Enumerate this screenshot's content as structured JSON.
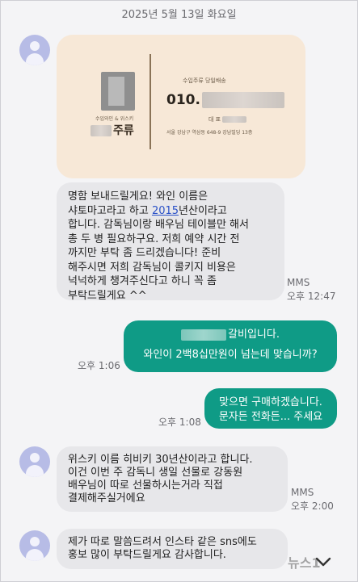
{
  "date_header": "2025년 5월 13일 화요일",
  "card": {
    "company_tag": "수입와인 & 위스키",
    "brand_suffix": "주류",
    "service_label": "수입주류 당일배송",
    "phone_prefix": "010.",
    "rep_label": "대 표",
    "address": "서울 강남구 역삼동 648-9 강남빌딩 13층"
  },
  "messages": [
    {
      "id": "m1",
      "direction": "incoming",
      "lines": [
        "명함 보내드릴게요! 와인 이름은",
        "샤토마고라고 하고 ",
        "합니다. 감독님이랑 배우님 테이블만 해서",
        "총 두 병 필요하구요. 저희 예약 시간 전",
        "까지만 부탁 좀 드리겠습니다! 준비",
        "해주시면 저희 감독님이 콜키지 비용은",
        "넉넉하게 챙겨주신다고 하니 꼭 좀",
        "부탁드릴게요 ^^"
      ],
      "link_text": "2015",
      "link_after": "년산이라고",
      "type": "MMS",
      "time": "오후 12:47"
    },
    {
      "id": "m2",
      "direction": "outgoing",
      "line1_suffix": "갈비입니다.",
      "line2": "와인이 2백8십만원이  넘는데  맞습니까?",
      "time": "오후 1:06"
    },
    {
      "id": "m3",
      "direction": "outgoing",
      "text": "맞으면 구매하겠습니다.\n문자든 전화든... 주세요",
      "time": "오후 1:08"
    },
    {
      "id": "m4",
      "direction": "incoming",
      "text": "위스키 이름 히비키 30년산이라고 합니다.\n이건 이번 주 감독니 생일 선물로 강동원\n배우님이 따로 선물하시는거라 직접\n결제해주실거에요",
      "type": "MMS",
      "time": "오후 2:00"
    },
    {
      "id": "m5",
      "direction": "incoming",
      "text": "제가 따로 말씀드려서 인스타 같은 sns에도\n홍보 많이 부탁드릴게요 감사합니다."
    }
  ],
  "watermark": "뉴스1",
  "icons": {
    "avatar": "person-avatar-icon",
    "scroll": "chevron-down-icon"
  },
  "colors": {
    "incoming_bubble": "#e7e7ea",
    "outgoing_bubble": "#0f9b86",
    "avatar": "#b7bce6",
    "card_bg": "#f7e8d7",
    "link": "#2b52c8"
  }
}
